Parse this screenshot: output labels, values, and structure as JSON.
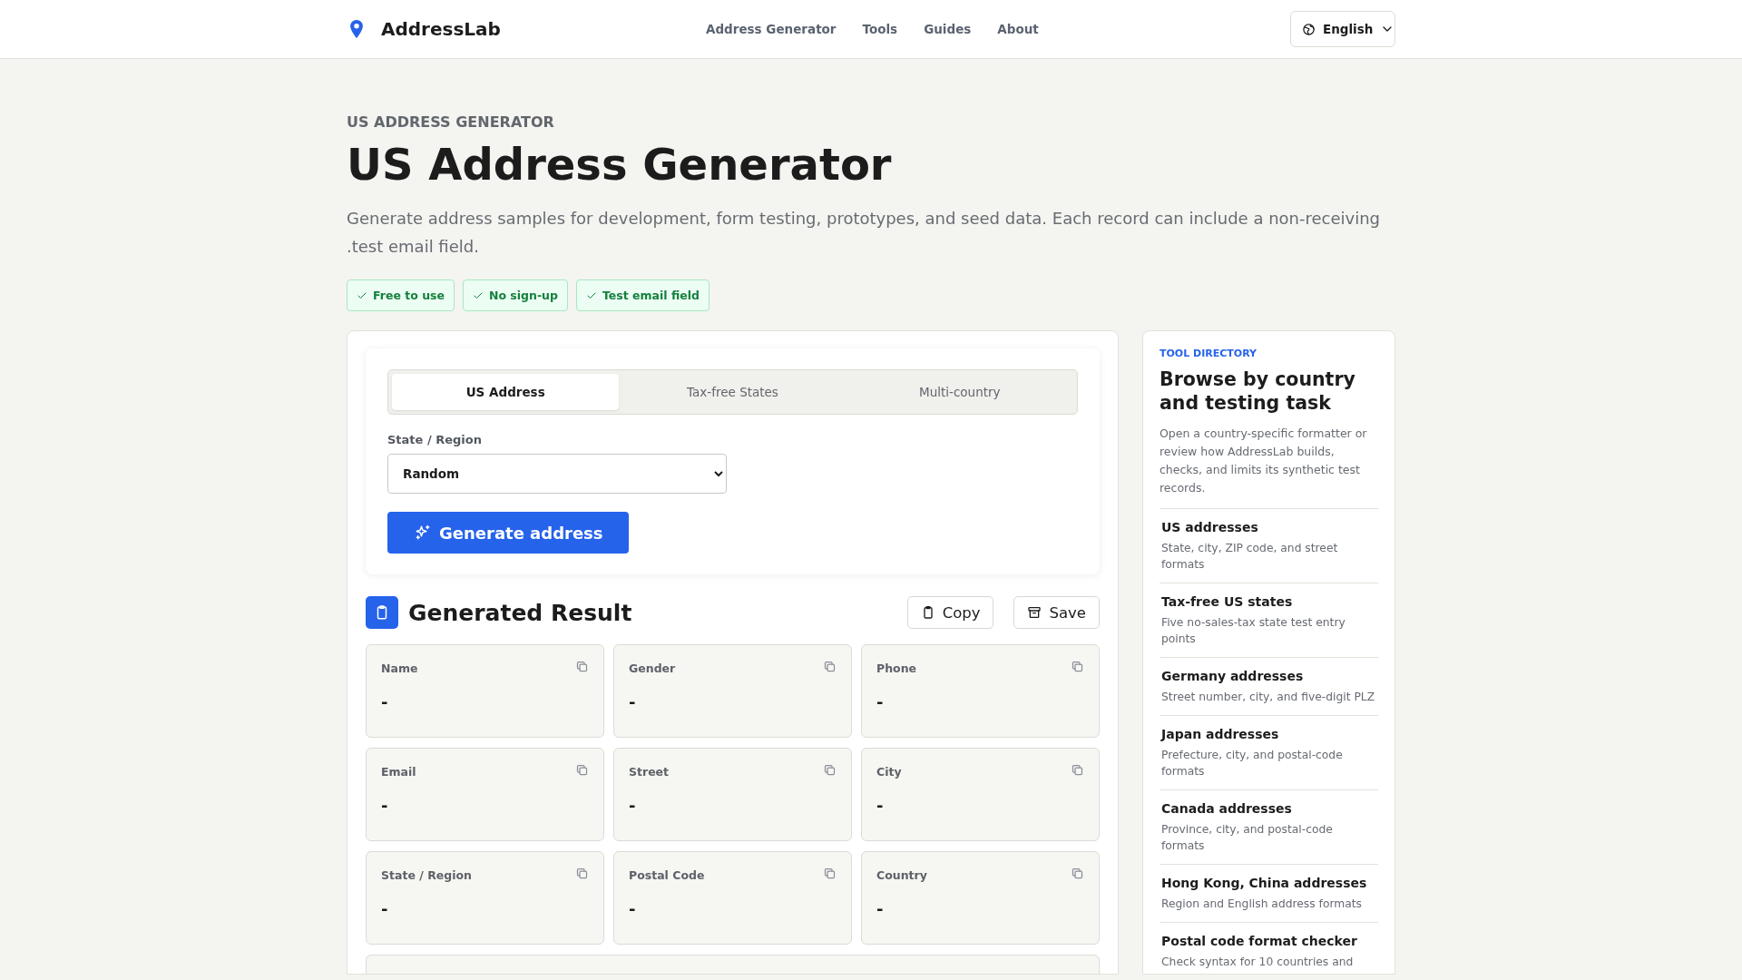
{
  "header": {
    "brand": "AddressLab",
    "nav": [
      {
        "label": "Address Generator"
      },
      {
        "label": "Tools"
      },
      {
        "label": "Guides"
      },
      {
        "label": "About"
      }
    ],
    "language": "English"
  },
  "hero": {
    "eyebrow": "US ADDRESS GENERATOR",
    "title": "US Address Generator",
    "description": "Generate address samples for development, form testing, prototypes, and seed data. Each record can include a non-receiving .test email field.",
    "badges": [
      "Free to use",
      "No sign-up",
      "Test email field"
    ]
  },
  "generator": {
    "tabs": [
      {
        "label": "US Address",
        "selected": true
      },
      {
        "label": "Tax-free States",
        "selected": false
      },
      {
        "label": "Multi-country",
        "selected": false
      }
    ],
    "field_label": "State / Region",
    "select_value": "Random",
    "button": "Generate address"
  },
  "result": {
    "title": "Generated Result",
    "actions": [
      {
        "label": "Copy",
        "kind": "copy"
      },
      {
        "label": "Save",
        "kind": "save"
      }
    ],
    "fields": [
      {
        "label": "Name",
        "value": "-"
      },
      {
        "label": "Gender",
        "value": "-"
      },
      {
        "label": "Phone",
        "value": "-"
      },
      {
        "label": "Email",
        "value": "-"
      },
      {
        "label": "Street",
        "value": "-"
      },
      {
        "label": "City",
        "value": "-"
      },
      {
        "label": "State / Region",
        "value": "-"
      },
      {
        "label": "Postal Code",
        "value": "-"
      },
      {
        "label": "Country",
        "value": "-"
      }
    ]
  },
  "directory": {
    "eyebrow": "TOOL DIRECTORY",
    "title": "Browse by country and testing task",
    "description": "Open a country-specific formatter or review how AddressLab builds, checks, and limits its synthetic test records.",
    "items": [
      {
        "title": "US addresses",
        "description": "State, city, ZIP code, and street formats"
      },
      {
        "title": "Tax-free US states",
        "description": "Five no-sales-tax state test entry points"
      },
      {
        "title": "Germany addresses",
        "description": "Street number, city, and five-digit PLZ"
      },
      {
        "title": "Japan addresses",
        "description": "Prefecture, city, and postal-code formats"
      },
      {
        "title": "Canada addresses",
        "description": "Province, city, and postal-code formats"
      },
      {
        "title": "Hong Kong, China addresses",
        "description": "Region and English address formats"
      },
      {
        "title": "Postal code format checker",
        "description": "Check syntax for 10 countries and"
      }
    ]
  }
}
